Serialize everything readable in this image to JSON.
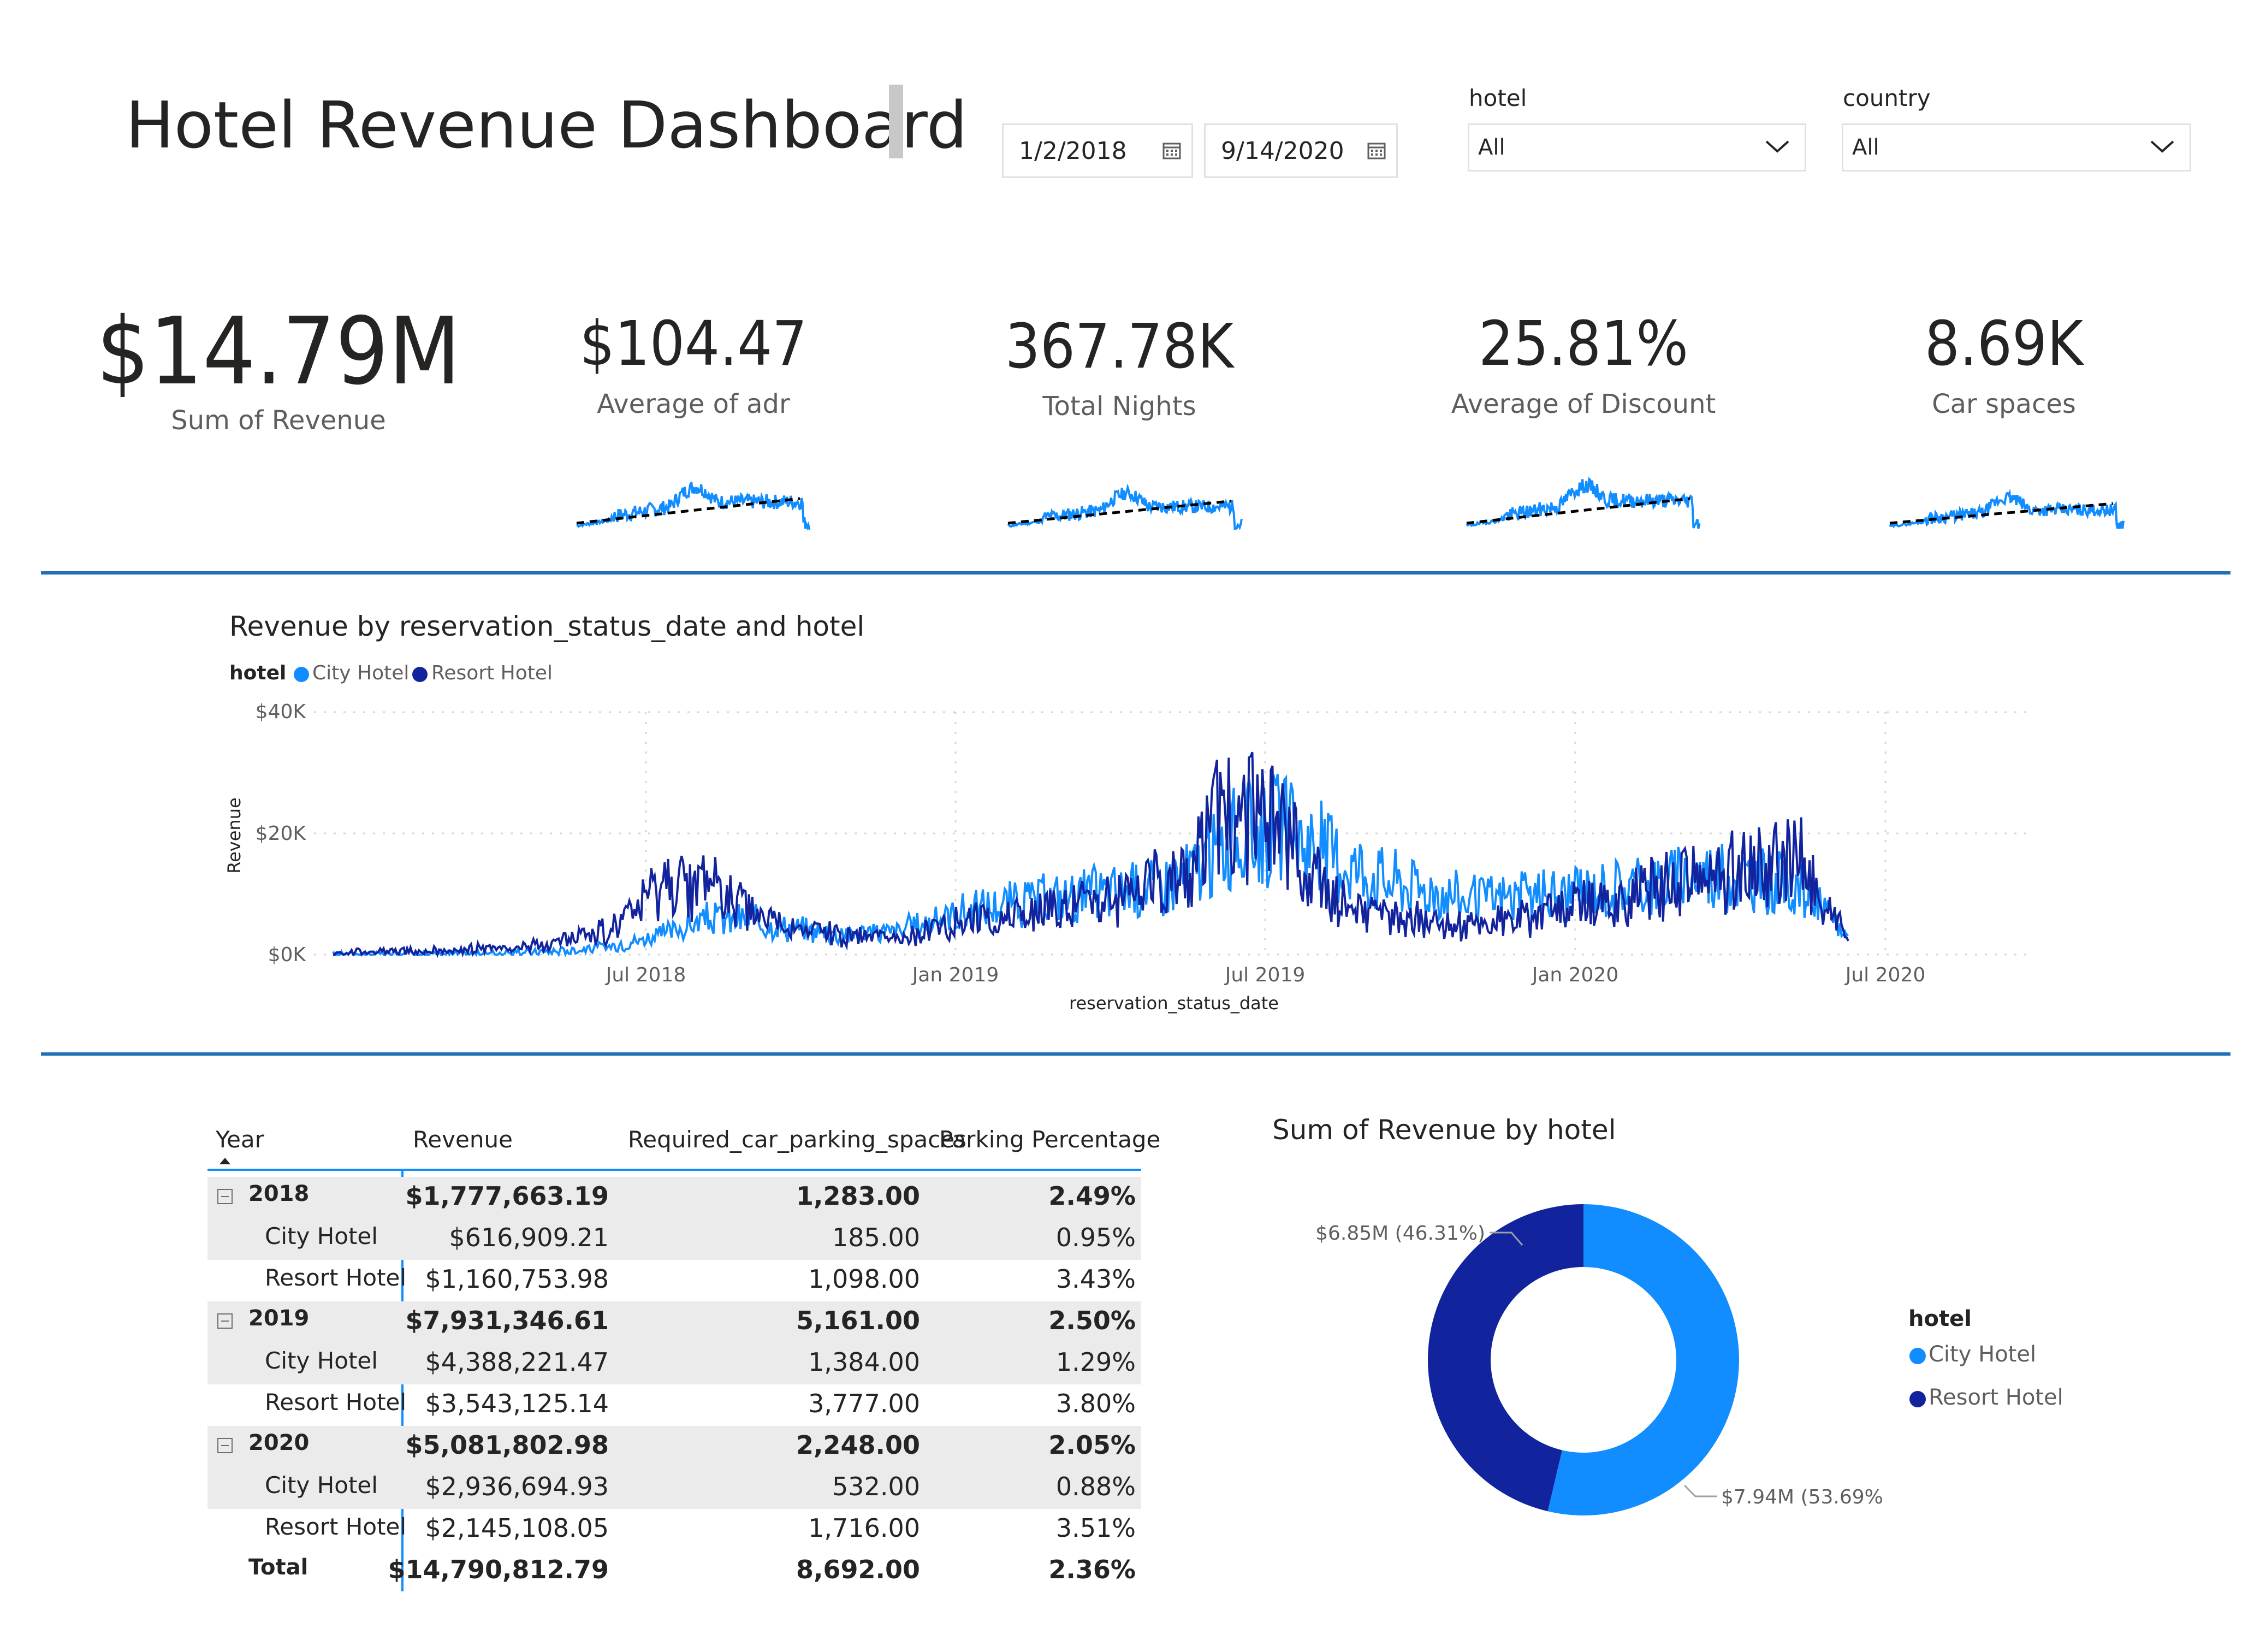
{
  "header": {
    "title": "Hotel Revenue Dashboard",
    "start_date": "1/2/2018",
    "end_date": "9/14/2020",
    "hotel_slicer": {
      "label": "hotel",
      "value": "All"
    },
    "country_slicer": {
      "label": "country",
      "value": "All"
    }
  },
  "kpis": [
    {
      "value": "$14.79M",
      "label": "Sum of Revenue"
    },
    {
      "value": "$104.47",
      "label": "Average of adr"
    },
    {
      "value": "367.78K",
      "label": "Total Nights"
    },
    {
      "value": "25.81%",
      "label": "Average of Discount"
    },
    {
      "value": "8.69K",
      "label": "Car spaces"
    }
  ],
  "line_chart": {
    "title": "Revenue by reservation_status_date and hotel",
    "legend_title": "hotel",
    "legend": [
      "City Hotel",
      "Resort Hotel"
    ],
    "ylabel": "Revenue",
    "xlabel": "reservation_status_date",
    "y_ticks": [
      "$40K",
      "$20K",
      "$0K"
    ],
    "x_ticks": [
      "Jul 2018",
      "Jan 2019",
      "Jul 2019",
      "Jan 2020",
      "Jul 2020"
    ]
  },
  "table": {
    "headers": [
      "Year",
      "Revenue",
      "Required_car_parking_spaces",
      "Parking Percentage"
    ],
    "rows": [
      {
        "label": "2018",
        "revenue": "$1,777,663.19",
        "parking": "1,283.00",
        "pct": "2.49%"
      },
      {
        "label": "City Hotel",
        "revenue": "$616,909.21",
        "parking": "185.00",
        "pct": "0.95%"
      },
      {
        "label": "Resort Hotel",
        "revenue": "$1,160,753.98",
        "parking": "1,098.00",
        "pct": "3.43%"
      },
      {
        "label": "2019",
        "revenue": "$7,931,346.61",
        "parking": "5,161.00",
        "pct": "2.50%"
      },
      {
        "label": "City Hotel",
        "revenue": "$4,388,221.47",
        "parking": "1,384.00",
        "pct": "1.29%"
      },
      {
        "label": "Resort Hotel",
        "revenue": "$3,543,125.14",
        "parking": "3,777.00",
        "pct": "3.80%"
      },
      {
        "label": "2020",
        "revenue": "$5,081,802.98",
        "parking": "2,248.00",
        "pct": "2.05%"
      },
      {
        "label": "City Hotel",
        "revenue": "$2,936,694.93",
        "parking": "532.00",
        "pct": "0.88%"
      },
      {
        "label": "Resort Hotel",
        "revenue": "$2,145,108.05",
        "parking": "1,716.00",
        "pct": "3.51%"
      },
      {
        "label": "Total",
        "revenue": "$14,790,812.79",
        "parking": "8,692.00",
        "pct": "2.36%"
      }
    ]
  },
  "donut": {
    "title": "Sum of Revenue by hotel",
    "legend_title": "hotel",
    "legend": [
      "City Hotel",
      "Resort Hotel"
    ],
    "label_city": "$7.94M (53.69%)",
    "label_resort": "$6.85M (46.31%)"
  },
  "colors": {
    "city": "#118dff",
    "resort": "#12239e",
    "divider": "#1f6fb8",
    "trend": "#000000"
  },
  "chart_data": [
    {
      "type": "line",
      "title": "Revenue by reservation_status_date and hotel",
      "xlabel": "reservation_status_date",
      "ylabel": "Revenue",
      "ylim": [
        0,
        40000
      ],
      "x": [
        "2018-01",
        "2018-03",
        "2018-05",
        "2018-06",
        "2018-07",
        "2018-08",
        "2018-09",
        "2018-10",
        "2018-11",
        "2018-12",
        "2019-01",
        "2019-02",
        "2019-03",
        "2019-04",
        "2019-05",
        "2019-06",
        "2019-07",
        "2019-08",
        "2019-09",
        "2019-10",
        "2019-11",
        "2019-12",
        "2020-01",
        "2020-02",
        "2020-03",
        "2020-04",
        "2020-05",
        "2020-06",
        "2020-07",
        "2020-08",
        "2020-09"
      ],
      "series": [
        {
          "name": "City Hotel",
          "values": [
            0,
            0,
            300,
            700,
            1500,
            3500,
            6000,
            5500,
            4000,
            3500,
            4000,
            6500,
            8000,
            9000,
            10000,
            11000,
            13000,
            19000,
            21000,
            17000,
            13000,
            11000,
            9000,
            9500,
            10000,
            11000,
            12000,
            13500,
            12500,
            11000,
            3000
          ]
        },
        {
          "name": "Resort Hotel",
          "values": [
            300,
            600,
            1200,
            2500,
            4500,
            11000,
            12000,
            6000,
            4000,
            3000,
            2500,
            5500,
            6000,
            7000,
            8500,
            10000,
            14000,
            25000,
            20000,
            10000,
            6000,
            5500,
            5000,
            6000,
            7500,
            9000,
            11000,
            13000,
            14500,
            16000,
            2000
          ]
        }
      ]
    },
    {
      "type": "pie",
      "title": "Sum of Revenue by hotel",
      "categories": [
        "City Hotel",
        "Resort Hotel"
      ],
      "values": [
        7940000,
        6850000
      ],
      "percent": [
        53.69,
        46.31
      ]
    }
  ]
}
